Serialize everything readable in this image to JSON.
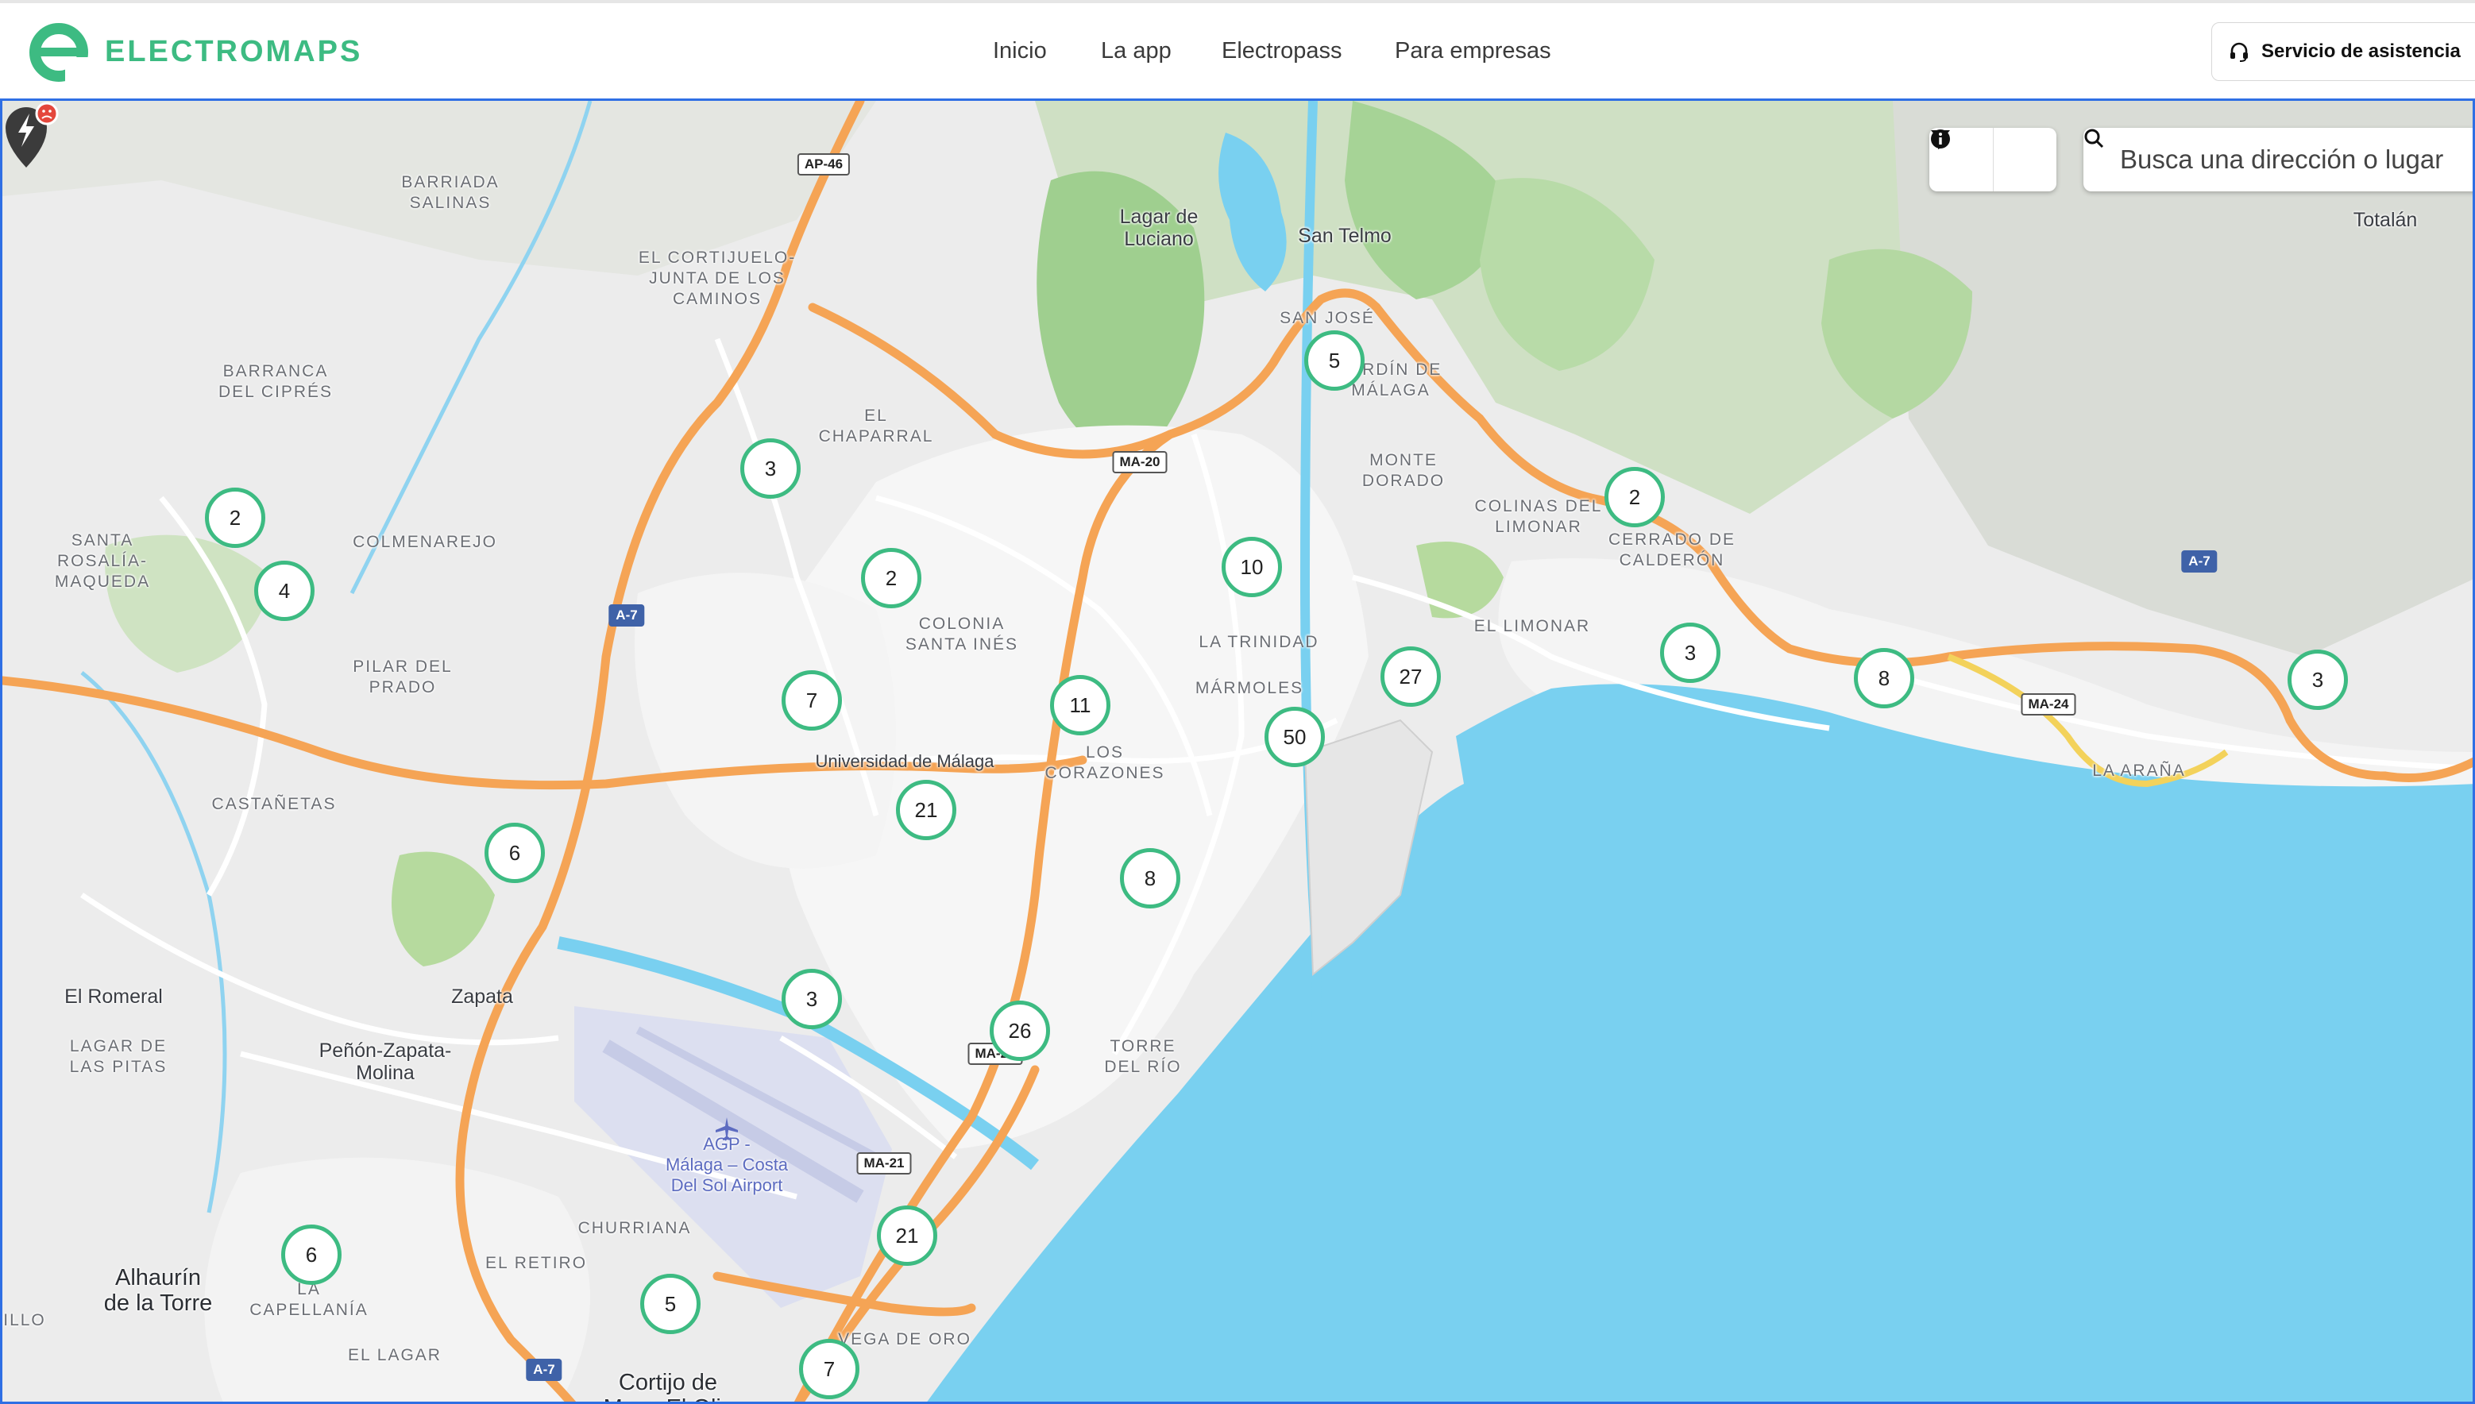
{
  "header": {
    "brand": "ELECTROMAPS",
    "nav": [
      "Inicio",
      "La app",
      "Electropass",
      "Para empresas"
    ],
    "support_label": "Servicio de asistencia",
    "brand_color": "#3dbb82"
  },
  "map": {
    "search_placeholder": "Busca una dirección o lugar",
    "filter_icon": "filter-icon",
    "info_icon": "info-icon",
    "clusters": [
      {
        "count": "5"
      },
      {
        "count": "2"
      },
      {
        "count": "4"
      },
      {
        "count": "3"
      },
      {
        "count": "2"
      },
      {
        "count": "10"
      },
      {
        "count": "2"
      },
      {
        "count": "7"
      },
      {
        "count": "11"
      },
      {
        "count": "27"
      },
      {
        "count": "50"
      },
      {
        "count": "3"
      },
      {
        "count": "8"
      },
      {
        "count": "3"
      },
      {
        "count": "21"
      },
      {
        "count": "6"
      },
      {
        "count": "8"
      },
      {
        "count": "3"
      },
      {
        "count": "26"
      },
      {
        "count": "21"
      },
      {
        "count": "6"
      },
      {
        "count": "5"
      },
      {
        "count": "7"
      }
    ],
    "labels": [
      "BARRIADA\nSALINAS",
      "EL CORTIJUELO-\nJUNTA DE LOS\nCAMINOS",
      "Lagar de\nLuciano",
      "San Telmo",
      "Totalán",
      "SAN JOSÉ",
      "JARDÍN DE\nMÁLAGA",
      "BARRANCA\nDEL CIPRÉS",
      "EL\nCHAPARRAL",
      "MONTE\nDORADO",
      "COLINAS DEL\nLIMONAR",
      "CERRADO DE\nCALDERÓN",
      "SANTA\nROSALÍA-\nMAQUEDA",
      "COLMENAREJO",
      "COLONIA\nSANTA INÉS",
      "LA TRINIDAD",
      "EL LIMONAR",
      "PILAR DEL\nPRADO",
      "MÁRMOLES",
      "Universidad de Málaga",
      "LOS\nCORAZONES",
      "LA ARAÑA",
      "CASTAÑETAS",
      "El Romeral",
      "Zapata",
      "LAGAR DE\nLAS PITAS",
      "Peñón-Zapata-\nMolina",
      "TORRE\nDEL RÍO",
      "AGP -\nMálaga – Costa\nDel Sol Airport",
      "CHURRIANA",
      "EL RETIRO",
      "Alhaurín\nde la Torre",
      "LA\nCAPELLANÍA",
      "EL LAGAR",
      "VEGA DE ORO",
      "Cortijo de\nMaza El Oliv",
      "ILLO"
    ],
    "roads": [
      "AP-46",
      "MA-20",
      "A-7",
      "A-7",
      "MA-24",
      "MA-20",
      "MA-21",
      "A-7"
    ]
  }
}
